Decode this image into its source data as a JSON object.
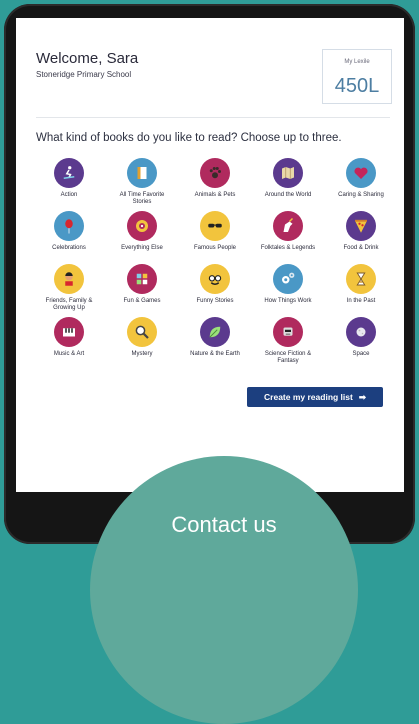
{
  "header": {
    "welcome": "Welcome, Sara",
    "school": "Stoneridge Primary School"
  },
  "lexile": {
    "label": "My Lexile",
    "value": "450L"
  },
  "question": "What kind of books do you like to read? Choose up to three.",
  "categories": [
    {
      "label": "Action",
      "color": "#5b3a8e",
      "icon": "skateboarder-icon"
    },
    {
      "label": "All Time Favorite Stories",
      "color": "#4a98c6",
      "icon": "book-icon"
    },
    {
      "label": "Animals & Pets",
      "color": "#b02a5e",
      "icon": "paw-icon"
    },
    {
      "label": "Around the World",
      "color": "#5b3a8e",
      "icon": "map-icon"
    },
    {
      "label": "Caring & Sharing",
      "color": "#4a98c6",
      "icon": "heart-icon"
    },
    {
      "label": "Celebrations",
      "color": "#4a98c6",
      "icon": "balloon-icon"
    },
    {
      "label": "Everything Else",
      "color": "#b02a5e",
      "icon": "target-icon"
    },
    {
      "label": "Famous People",
      "color": "#f2c43d",
      "icon": "sunglasses-icon"
    },
    {
      "label": "Folktales & Legends",
      "color": "#b02a5e",
      "icon": "unicorn-icon"
    },
    {
      "label": "Food & Drink",
      "color": "#5b3a8e",
      "icon": "pizza-icon"
    },
    {
      "label": "Friends, Family & Growing Up",
      "color": "#f2c43d",
      "icon": "person-icon"
    },
    {
      "label": "Fun & Games",
      "color": "#b02a5e",
      "icon": "puzzle-icon"
    },
    {
      "label": "Funny Stories",
      "color": "#f2c43d",
      "icon": "funny-glasses-icon"
    },
    {
      "label": "How Things Work",
      "color": "#4a98c6",
      "icon": "gears-icon"
    },
    {
      "label": "In the Past",
      "color": "#f2c43d",
      "icon": "hourglass-icon"
    },
    {
      "label": "Music & Art",
      "color": "#b02a5e",
      "icon": "piano-icon"
    },
    {
      "label": "Mystery",
      "color": "#f2c43d",
      "icon": "magnifier-icon"
    },
    {
      "label": "Nature & the Earth",
      "color": "#5b3a8e",
      "icon": "leaf-icon"
    },
    {
      "label": "Science Fiction & Fantasy",
      "color": "#b02a5e",
      "icon": "robot-icon"
    },
    {
      "label": "Space",
      "color": "#5b3a8e",
      "icon": "moon-icon"
    }
  ],
  "create_button": {
    "label": "Create my reading list",
    "arrow": "➡"
  },
  "contact": {
    "label": "Contact us"
  }
}
